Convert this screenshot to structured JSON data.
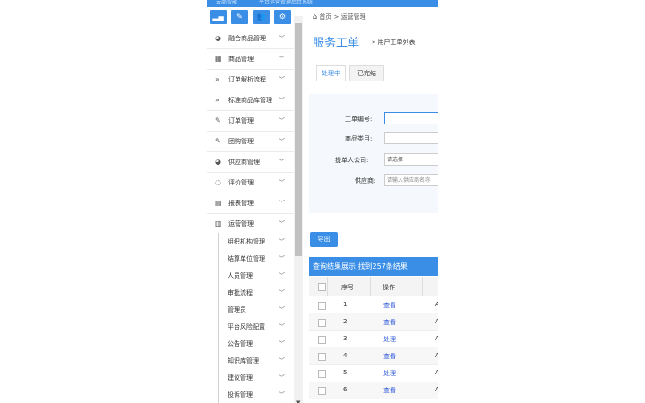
{
  "topbar": {
    "logo": "云商智能",
    "title": "平台运营管理后台系统"
  },
  "toolbar": {
    "buttons": [
      {
        "icon": "bar-chart-icon",
        "glyph": "▂▄"
      },
      {
        "icon": "pencil-icon",
        "glyph": "✎"
      },
      {
        "icon": "users-icon",
        "glyph": "👥"
      },
      {
        "icon": "settings-icon",
        "glyph": "⚙"
      }
    ]
  },
  "sidebar": {
    "items": [
      {
        "icon": "globe-icon",
        "glyph": "◕",
        "label": "融合商品管理"
      },
      {
        "icon": "qrcode-icon",
        "glyph": "▦",
        "label": "商品管理"
      },
      {
        "icon": "double-chevron-icon",
        "glyph": "»",
        "label": "订单解析流程"
      },
      {
        "icon": "double-chevron-icon",
        "glyph": "»",
        "label": "标准商品库管理"
      },
      {
        "icon": "edit-icon",
        "glyph": "✎",
        "label": "订单管理"
      },
      {
        "icon": "edit-icon",
        "glyph": "✎",
        "label": "团购管理"
      },
      {
        "icon": "globe-icon",
        "glyph": "◕",
        "label": "供应商管理"
      },
      {
        "icon": "comment-icon",
        "glyph": "◌",
        "label": "评价管理"
      },
      {
        "icon": "table-icon",
        "glyph": "▤",
        "label": "报表管理"
      },
      {
        "icon": "chart-icon",
        "glyph": "▥",
        "label": "运营管理"
      }
    ],
    "subitems": [
      {
        "label": "组织机构管理",
        "chev": true
      },
      {
        "label": "结算单位管理",
        "chev": true
      },
      {
        "label": "人员管理",
        "chev": true
      },
      {
        "label": "审批流程",
        "chev": true
      },
      {
        "label": "管理员",
        "chev": true
      },
      {
        "label": "平台风险配置",
        "chev": true
      },
      {
        "label": "公告管理",
        "chev": true
      },
      {
        "label": "知识库管理",
        "chev": true
      },
      {
        "label": "建议管理",
        "chev": true
      },
      {
        "label": "投诉管理",
        "chev": true
      }
    ]
  },
  "breadcrumb": {
    "home": "首页",
    "sep": ">",
    "current": "运营管理"
  },
  "page": {
    "title": "服务工单",
    "subtitle": "» 用户工单列表"
  },
  "tabs": [
    {
      "label": "处理中"
    },
    {
      "label": "已完结"
    }
  ],
  "form": {
    "fields": [
      {
        "label": "工单编号:",
        "value": "",
        "placeholder": ""
      },
      {
        "label": "商品类目:",
        "value": "",
        "placeholder": ""
      },
      {
        "label": "提单人公司:",
        "value": "请选择",
        "placeholder": ""
      },
      {
        "label": "供应商:",
        "value": "",
        "placeholder": "请输入供应商名称"
      }
    ]
  },
  "export_label": "导出",
  "results": {
    "header": "查询结果展示  找到257条结果"
  },
  "table": {
    "columns": [
      "序号",
      "操作"
    ],
    "rows": [
      {
        "idx": "1",
        "op": "查看",
        "a": "A"
      },
      {
        "idx": "2",
        "op": "查看",
        "a": "A"
      },
      {
        "idx": "3",
        "op": "处理",
        "a": "A"
      },
      {
        "idx": "4",
        "op": "查看",
        "a": "A"
      },
      {
        "idx": "5",
        "op": "处理",
        "a": "A"
      },
      {
        "idx": "6",
        "op": "查看",
        "a": "A"
      }
    ]
  }
}
